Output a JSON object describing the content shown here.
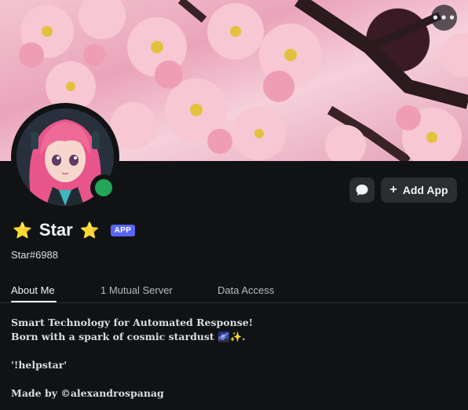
{
  "header": {
    "more_icon_glyph": "•••",
    "message_icon": "speech-bubble-icon",
    "add_app_label": "Add App",
    "add_app_icon_glyph": "+"
  },
  "profile": {
    "name": "Star",
    "name_prefix_emoji": "⭐",
    "name_suffix_emoji": "⭐",
    "badge": "APP",
    "tag": "Star#6988",
    "status_color": "#23a55a"
  },
  "tabs": [
    {
      "label": "About Me",
      "active": true
    },
    {
      "label": "1 Mutual Server",
      "active": false
    },
    {
      "label": "Data Access",
      "active": false
    }
  ],
  "about": {
    "line1": "Smart Technology for Automated Response!",
    "line2": "Born with a spark of cosmic stardust 🌌✨.",
    "command": "'!helpstar'",
    "credit": "Made by ©alexandrospanag"
  },
  "colors": {
    "background": "#111214",
    "button_bg": "#2b2d31",
    "badge_bg": "#5865f2",
    "status_online": "#23a55a"
  }
}
